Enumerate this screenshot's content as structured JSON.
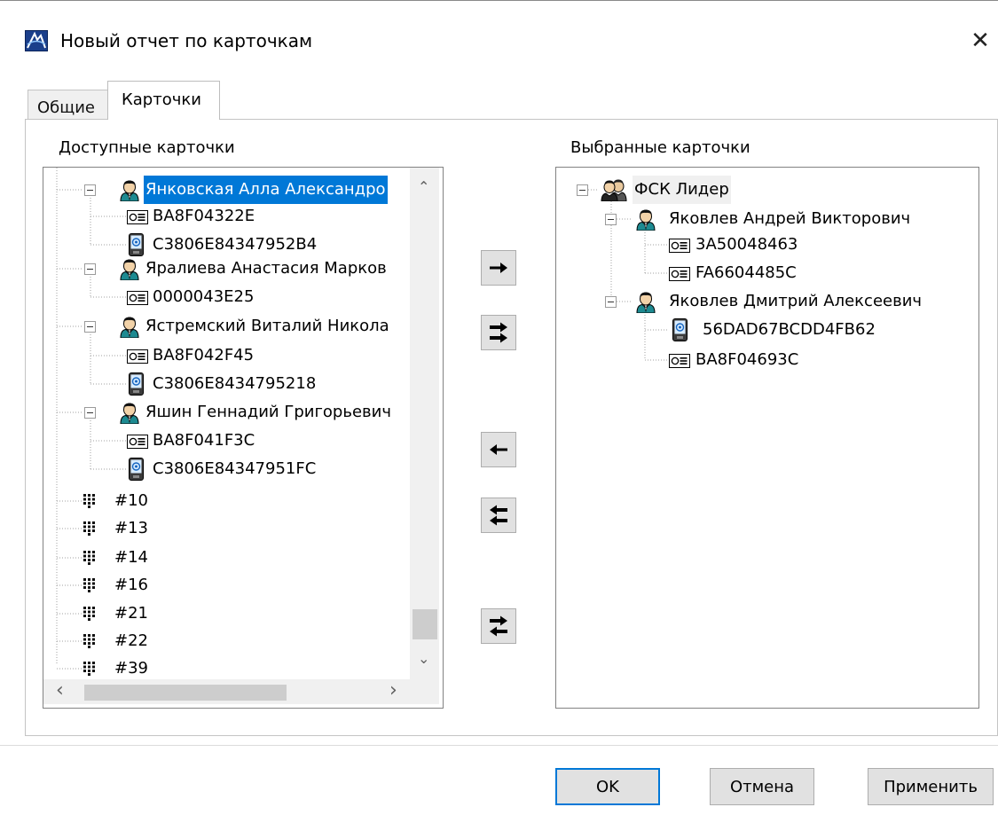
{
  "window": {
    "title": "Новый отчет по карточкам",
    "close_glyph": "✕"
  },
  "tabs": [
    {
      "label": "Общие",
      "active": false
    },
    {
      "label": "Карточки",
      "active": true
    }
  ],
  "available": {
    "label": "Доступные карточки",
    "items": [
      {
        "name": "Янковская Алла Александро",
        "selected": true,
        "icon": "person-icon"
      },
      {
        "name": "BA8F04322E",
        "icon": "id-card-icon"
      },
      {
        "name": "C3806E84347952B4",
        "icon": "phone-tag-icon"
      },
      {
        "name": "Яралиева Анастасия Марков",
        "icon": "person-icon"
      },
      {
        "name": "0000043E25",
        "icon": "id-card-icon"
      },
      {
        "name": "Ястремский Виталий Никола",
        "icon": "person-icon"
      },
      {
        "name": "BA8F042F45",
        "icon": "id-card-icon"
      },
      {
        "name": "C3806E8434795218",
        "icon": "phone-tag-icon"
      },
      {
        "name": "Яшин Геннадий Григорьевич",
        "icon": "person-icon"
      },
      {
        "name": "BA8F041F3C",
        "icon": "id-card-icon"
      },
      {
        "name": "C3806E84347951FC",
        "icon": "phone-tag-icon"
      },
      {
        "name": "#10",
        "icon": "keypad-icon"
      },
      {
        "name": "#13",
        "icon": "keypad-icon"
      },
      {
        "name": "#14",
        "icon": "keypad-icon"
      },
      {
        "name": "#16",
        "icon": "keypad-icon"
      },
      {
        "name": "#21",
        "icon": "keypad-icon"
      },
      {
        "name": "#22",
        "icon": "keypad-icon"
      },
      {
        "name": "#39",
        "icon": "keypad-icon"
      }
    ]
  },
  "selected": {
    "label": "Выбранные карточки",
    "items": [
      {
        "name": "ФСК Лидер",
        "icon": "group-icon"
      },
      {
        "name": "Яковлев Андрей Викторович",
        "icon": "person-icon"
      },
      {
        "name": "3A50048463",
        "icon": "id-card-icon"
      },
      {
        "name": "FA6604485C",
        "icon": "id-card-icon"
      },
      {
        "name": "Яковлев Дмитрий Алексеевич",
        "icon": "person-icon"
      },
      {
        "name": "56DAD67BCDD4FB62",
        "icon": "phone-tag-icon"
      },
      {
        "name": "BA8F04693C",
        "icon": "id-card-icon"
      }
    ]
  },
  "transfer_buttons": [
    "move-right",
    "move-all-right",
    "move-left",
    "move-all-left",
    "swap"
  ],
  "buttons": {
    "ok": "OK",
    "cancel": "Отмена",
    "apply": "Применить"
  },
  "scroll_arrows": {
    "up": "⌃",
    "down": "⌄",
    "left": "‹",
    "right": "›"
  },
  "colors": {
    "selection": "#0078d7",
    "default_button_border": "#0078d7"
  }
}
